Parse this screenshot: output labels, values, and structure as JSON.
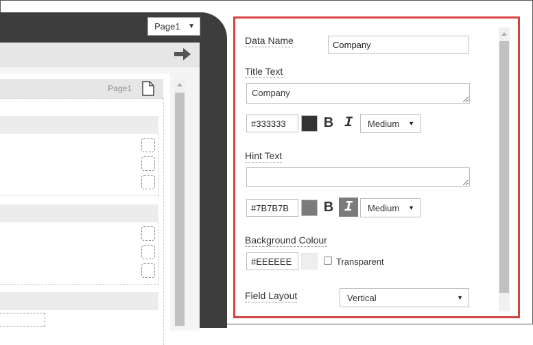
{
  "device": {
    "page_select": {
      "value": "Page1"
    },
    "page_header": {
      "label": "Page1"
    }
  },
  "panel": {
    "data_name": {
      "label": "Data Name",
      "value": "Company"
    },
    "title_text": {
      "label": "Title Text",
      "value": "Company",
      "color": "#333333",
      "swatch_color": "#333333",
      "bold_label": "B",
      "italic_label": "I",
      "size": "Medium"
    },
    "hint_text": {
      "label": "Hint Text",
      "value": "",
      "color": "#7B7B7B",
      "swatch_color": "#7B7B7B",
      "bold_label": "B",
      "italic_label": "I",
      "italic_active": true,
      "size": "Medium"
    },
    "background_colour": {
      "label": "Background Colour",
      "value": "#EEEEEE",
      "swatch_color": "#EEEEEE",
      "transparent_label": "Transparent",
      "transparent_checked": false
    },
    "field_layout": {
      "label": "Field Layout",
      "value": "Vertical"
    }
  },
  "colors": {
    "panel_border": "#d9413f",
    "device": "#3d3d3d"
  }
}
